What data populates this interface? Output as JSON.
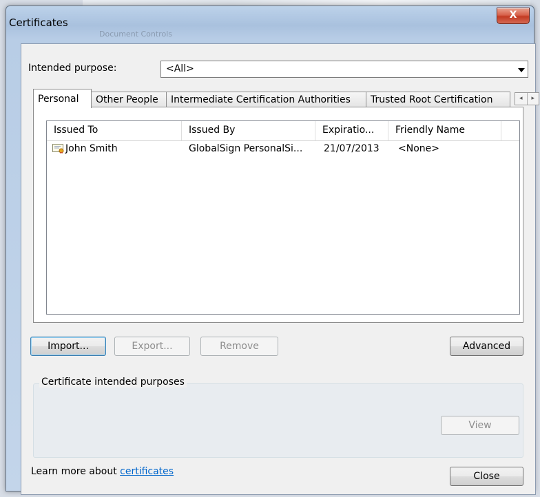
{
  "window": {
    "title": "Certificates",
    "background_title": "Document Controls",
    "close_glyph": "X"
  },
  "intended_purpose": {
    "label": "Intended purpose:",
    "value": "<All>"
  },
  "tabs": [
    {
      "label": "Personal",
      "active": true
    },
    {
      "label": "Other People",
      "active": false
    },
    {
      "label": "Intermediate Certification Authorities",
      "active": false
    },
    {
      "label": "Trusted Root Certification",
      "active": false
    }
  ],
  "tab_scroll": {
    "left": "◂",
    "right": "▸"
  },
  "list": {
    "columns": [
      "Issued To",
      "Issued By",
      "Expiratio...",
      "Friendly Name"
    ],
    "rows": [
      {
        "issued_to": "John Smith",
        "issued_by": "GlobalSign PersonalSi...",
        "expiration": "21/07/2013",
        "friendly_name": "<None>",
        "icon": "certificate-icon"
      }
    ]
  },
  "buttons": {
    "import": "Import...",
    "export": "Export...",
    "remove": "Remove",
    "advanced": "Advanced",
    "view": "View",
    "close": "Close"
  },
  "purposes_group": {
    "title": "Certificate intended purposes"
  },
  "footer": {
    "text": "Learn more about ",
    "link": "certificates"
  },
  "colors": {
    "link": "#0066cc",
    "close_button": "#c23a22",
    "title_bar": "#a9c1de"
  }
}
